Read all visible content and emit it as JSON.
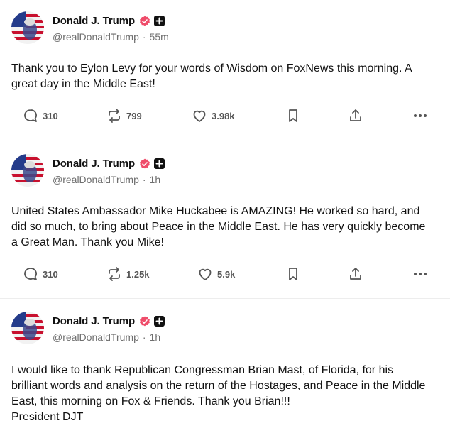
{
  "posts": [
    {
      "author": "Donald J. Trump",
      "handle": "@realDonaldTrump",
      "separator": "·",
      "time": "55m",
      "text": "Thank you to Eylon Levy for your words of Wisdom on FoxNews this morning. A great day in the Middle East!",
      "replies": "310",
      "reposts": "799",
      "likes": "3.98k"
    },
    {
      "author": "Donald J. Trump",
      "handle": "@realDonaldTrump",
      "separator": "·",
      "time": "1h",
      "text": "United States Ambassador Mike Huckabee is AMAZING! He worked so hard, and did so much, to bring about Peace in the Middle East. He has very quickly become a Great Man. Thank you Mike!",
      "replies": "310",
      "reposts": "1.25k",
      "likes": "5.9k"
    },
    {
      "author": "Donald J. Trump",
      "handle": "@realDonaldTrump",
      "separator": "·",
      "time": "1h",
      "text": "I would like to thank Republican Congressman Brian Mast, of Florida, for his brilliant words and analysis on the return of the Hostages, and Peace in the Middle East, this morning on Fox & Friends. Thank you Brian!!!\nPresident DJT"
    }
  ],
  "colors": {
    "verified": "#ef4c6a",
    "icon": "#555555",
    "text": "#111111",
    "muted": "#6e6e6e"
  },
  "icons": [
    "verified-badge-icon",
    "plus-square-icon",
    "reply-icon",
    "repost-icon",
    "like-icon",
    "bookmark-icon",
    "share-icon",
    "more-icon"
  ]
}
